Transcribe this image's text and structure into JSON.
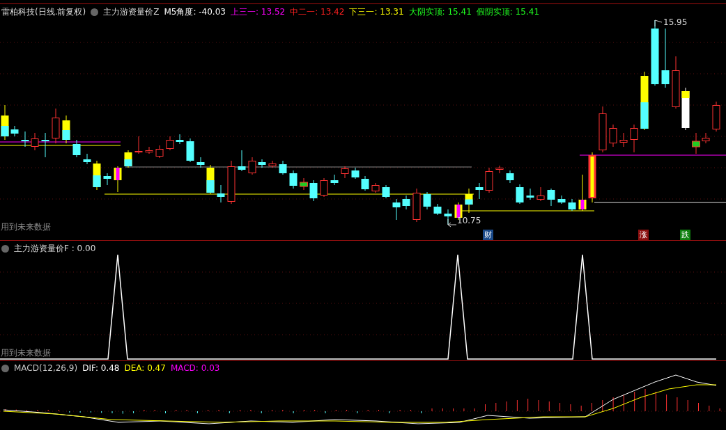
{
  "main_panel": {
    "title": "雷柏科技(日线.前复权)",
    "indicator": "主力游资量价Z",
    "legend": [
      {
        "text": "M5角度: -40.03",
        "color": "#ffffff"
      },
      {
        "text": "上三一: 13.52",
        "color": "#ff00ff"
      },
      {
        "text": "中二一: 13.42",
        "color": "#ff2020"
      },
      {
        "text": "下三一: 13.31",
        "color": "#ffff00"
      },
      {
        "text": "大阴实顶: 15.41",
        "color": "#20ff20"
      },
      {
        "text": "假阴实顶: 15.41",
        "color": "#20ff20"
      }
    ],
    "high_label": "15.95",
    "low_label": "10.75",
    "future_note": "用到未来数据",
    "markers": [
      {
        "text": "财",
        "color": "#1a4a8a"
      },
      {
        "text": "涨",
        "color": "#8b1010"
      },
      {
        "text": "跌",
        "color": "#108010"
      }
    ]
  },
  "f_panel": {
    "title": "主力游资量价F : 0.00",
    "future_note": "用到未来数据"
  },
  "macd_panel": {
    "legend": [
      {
        "text": "MACD(12,26,9)",
        "color": "#c8c8c8"
      },
      {
        "text": "DIF: 0.48",
        "color": "#ffffff"
      },
      {
        "text": "DEA: 0.47",
        "color": "#ffff00"
      },
      {
        "text": "MACD: 0.03",
        "color": "#ff00ff"
      }
    ]
  }
}
